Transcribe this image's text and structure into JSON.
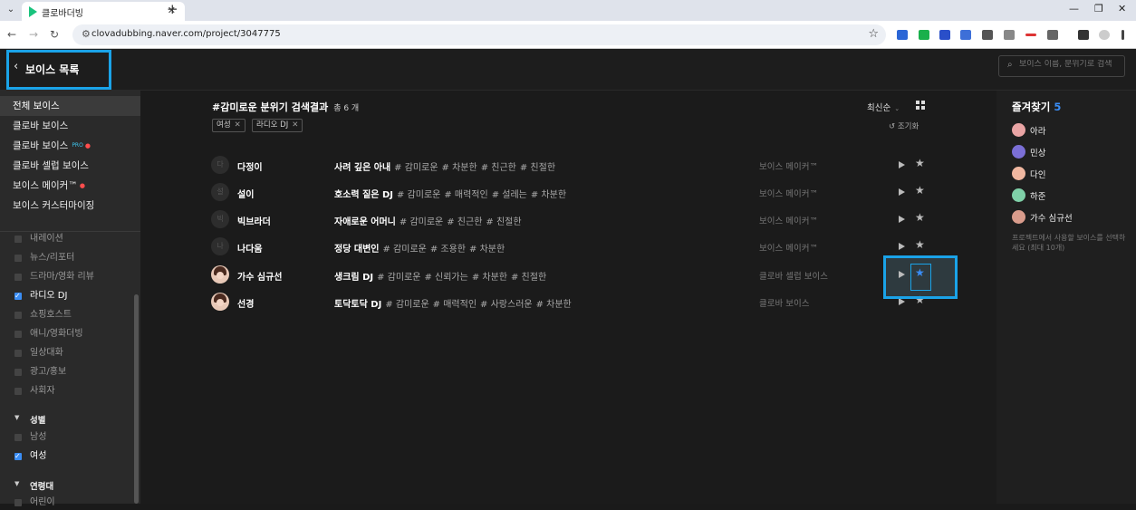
{
  "browser": {
    "tab_title": "클로바더빙",
    "url": "clovadubbing.naver.com/project/3047775"
  },
  "header": {
    "back_label": "보이스 목록",
    "search_placeholder": "보이스 이름, 분위기로 검색"
  },
  "sidebar": {
    "categories": [
      {
        "label": "전체 보이스"
      },
      {
        "label": "클로바 보이스"
      },
      {
        "label": "클로바 보이스",
        "badge": "PRO"
      },
      {
        "label": "클로바 셀럽 보이스"
      },
      {
        "label": "보이스 메이커™"
      },
      {
        "label": "보이스 커스터마이징"
      }
    ],
    "genres": [
      {
        "label": "내레이션",
        "checked": false
      },
      {
        "label": "뉴스/리포터",
        "checked": false
      },
      {
        "label": "드라마/영화 리뷰",
        "checked": false
      },
      {
        "label": "라디오 DJ",
        "checked": true
      },
      {
        "label": "쇼핑호스트",
        "checked": false
      },
      {
        "label": "애니/영화더빙",
        "checked": false
      },
      {
        "label": "일상대화",
        "checked": false
      },
      {
        "label": "광고/홍보",
        "checked": false
      },
      {
        "label": "사회자",
        "checked": false
      }
    ],
    "gender_group": "성별",
    "genders": [
      {
        "label": "남성",
        "checked": false
      },
      {
        "label": "여성",
        "checked": true
      }
    ],
    "age_group": "연령대",
    "age_first": "어린이"
  },
  "results": {
    "title": "#감미로운 분위기 검색결과",
    "count": "총 6 개",
    "chips": [
      "여성",
      "라디오 DJ"
    ],
    "sort_label": "최신순",
    "reset_label": "조기화",
    "rows": [
      {
        "avatar": "다",
        "name": "다정이",
        "desc": "사려 깊은 아내",
        "tags": [
          "# 감미로운",
          "# 차분한",
          "# 친근한",
          "# 친절한"
        ],
        "source": "보이스 메이커™",
        "fav": false
      },
      {
        "avatar": "설",
        "name": "설이",
        "desc": "호소력 짙은 DJ",
        "tags": [
          "# 감미로운",
          "# 매력적인",
          "# 설레는",
          "# 차분한"
        ],
        "source": "보이스 메이커™",
        "fav": false
      },
      {
        "avatar": "빅",
        "name": "빅브라더",
        "desc": "자애로운 어머니",
        "tags": [
          "# 감미로운",
          "# 친근한",
          "# 친절한"
        ],
        "source": "보이스 메이커™",
        "fav": false
      },
      {
        "avatar": "나",
        "name": "나다움",
        "desc": "정당 대변인",
        "tags": [
          "# 감미로운",
          "# 조용한",
          "# 차분한"
        ],
        "source": "보이스 메이커™",
        "fav": false
      },
      {
        "avatar": "",
        "name": "가수 심규선",
        "desc": "생크림 DJ",
        "tags": [
          "# 감미로운",
          "# 신뢰가는",
          "# 차분한",
          "# 친절한"
        ],
        "source": "클로바 셀럽 보이스",
        "fav": true
      },
      {
        "avatar": "",
        "name": "선경",
        "desc": "토닥토닥 DJ",
        "tags": [
          "# 감미로운",
          "# 매력적인",
          "# 사랑스러운",
          "# 차분한"
        ],
        "source": "클로바 보이스",
        "fav": false
      }
    ]
  },
  "favorites": {
    "title": "즐겨찾기",
    "count": "5",
    "items": [
      {
        "name": "아라",
        "color": "#e9a4a4"
      },
      {
        "name": "민상",
        "color": "#7b6fd6"
      },
      {
        "name": "다인",
        "color": "#f0b7a0"
      },
      {
        "name": "하준",
        "color": "#7fd0a8"
      },
      {
        "name": "가수 심규선",
        "color": "#d99c8c"
      }
    ],
    "hint": "프로젝트에서 사용할 보이스를 선택하세요 (최대 10개)"
  },
  "colors": {
    "accent": "#3a8df5",
    "highlight": "#1aa3e8"
  }
}
